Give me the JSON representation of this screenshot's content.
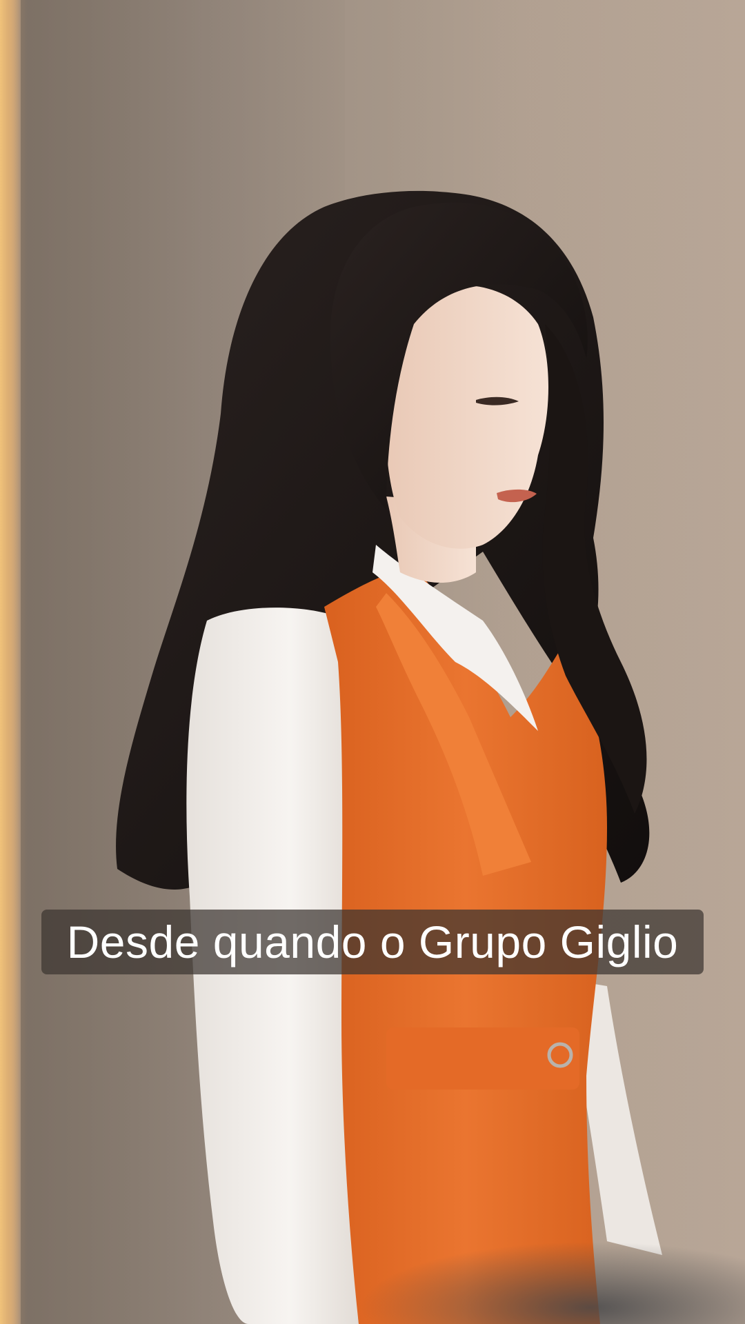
{
  "video": {
    "subtitle": "Desde quando o Grupo Giglio"
  },
  "colors": {
    "vest": "#e8702a",
    "shirt": "#f4f1ee",
    "hair": "#1c1715",
    "skin": "#f1d8c9",
    "wall": "#a89a8e",
    "subtitle_bg": "#3c3430"
  }
}
